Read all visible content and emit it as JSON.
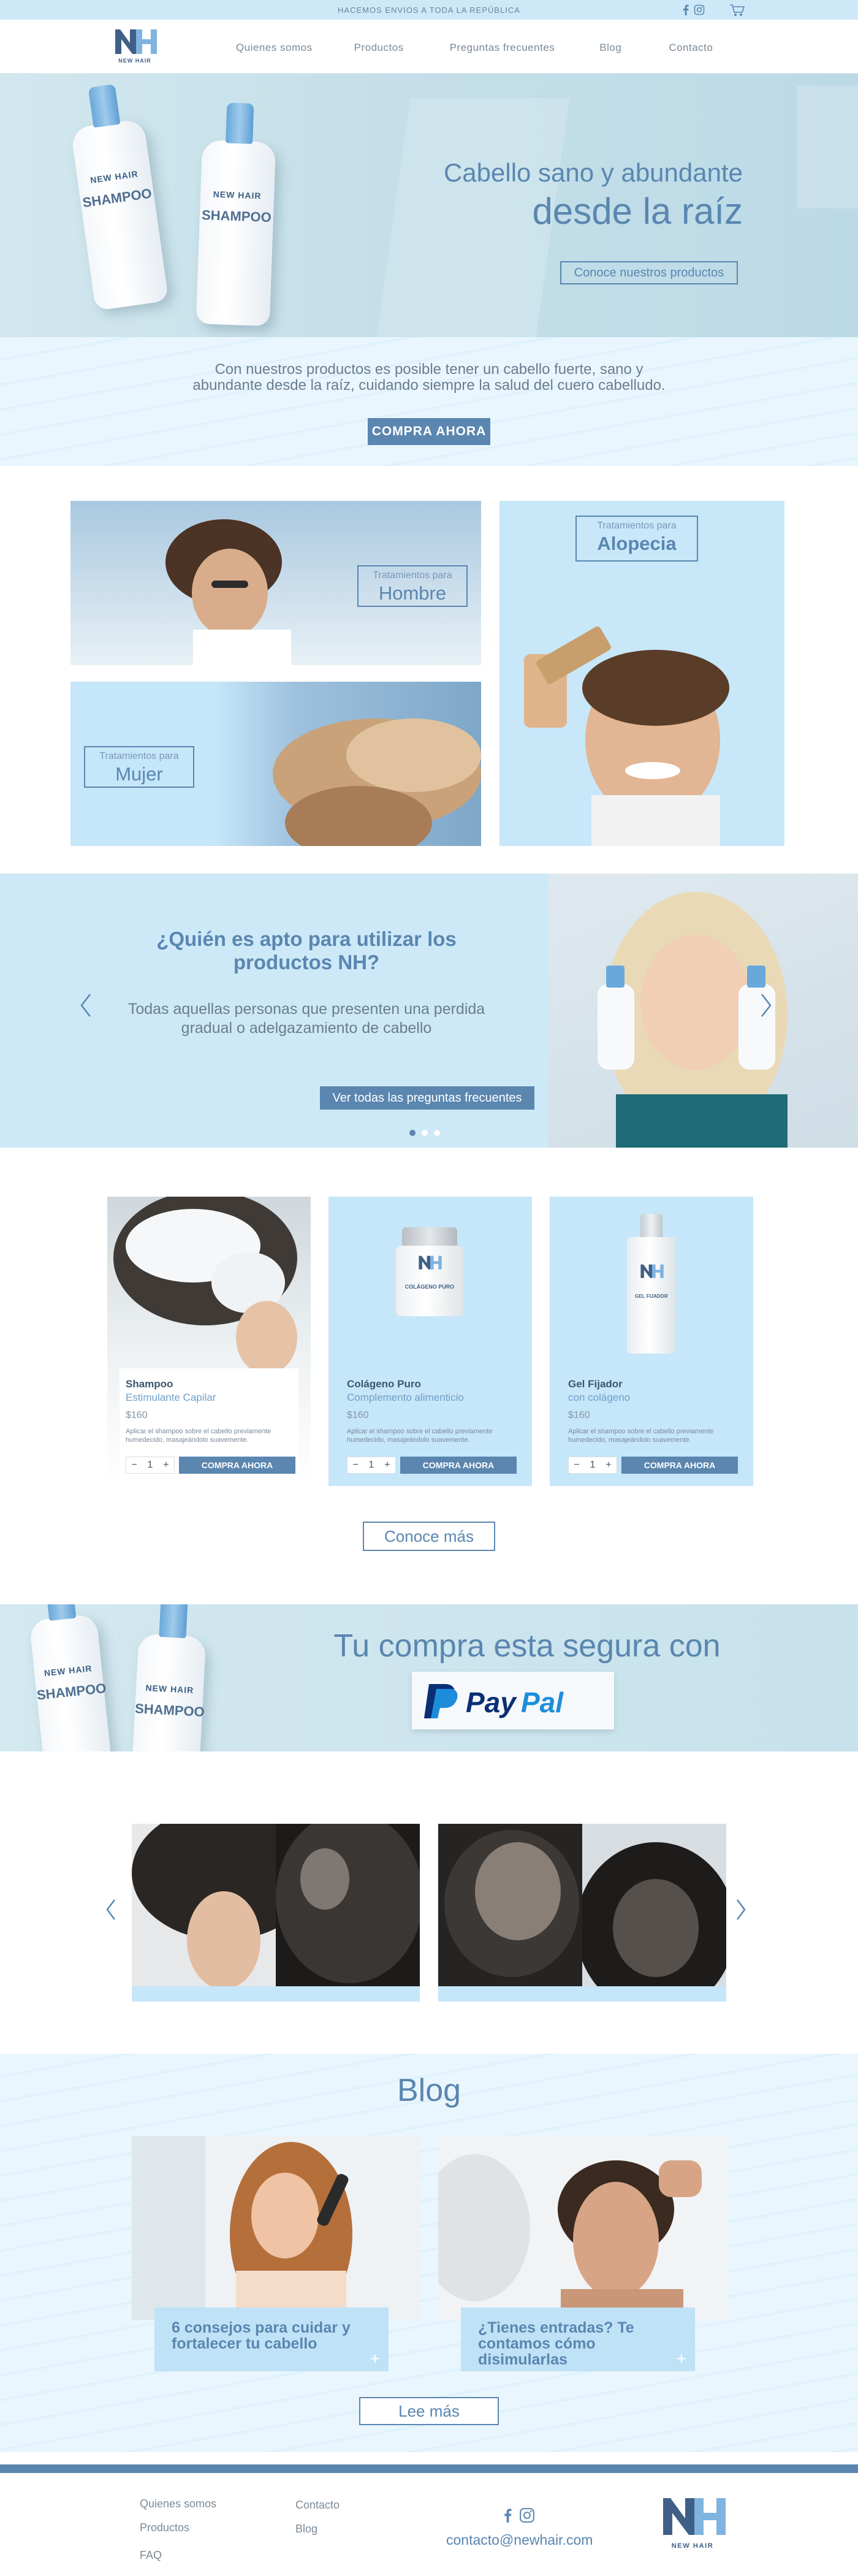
{
  "topbar": {
    "shipping": "HACEMOS ENVIOS A TODA LA REPÚBLICA",
    "social_icons": [
      "facebook-icon",
      "instagram-icon"
    ],
    "cart_icon": "cart-icon"
  },
  "brand": {
    "logo_text": "NEW HAIR",
    "logo_letters": "NH",
    "accent_color": "#5a86b0",
    "light_blue": "#cde9f8"
  },
  "nav": {
    "items": [
      {
        "label": "Quienes somos"
      },
      {
        "label": "Productos"
      },
      {
        "label": "Preguntas frecuentes"
      },
      {
        "label": "Blog"
      },
      {
        "label": "Contacto"
      }
    ]
  },
  "hero": {
    "title_line1": "Cabello sano y abundante",
    "title_line2": "desde la raíz",
    "cta": "Conoce nuestros productos",
    "bottle_brand": "NEW HAIR",
    "bottle_product": "SHAMPOO"
  },
  "intro": {
    "text": "Con nuestros productos es posible tener un cabello fuerte, sano y abundante desde la raíz, cuidando siempre la salud del cuero cabelludo.",
    "button": "COMPRA AHORA"
  },
  "treatments": [
    {
      "small": "Tratamientos para",
      "big": "Hombre"
    },
    {
      "small": "Tratamientos para",
      "big": "Mujer"
    },
    {
      "small": "Tratamientos para",
      "big": "Alopecia"
    }
  ],
  "faq": {
    "question": "¿Quién es apto para utilizar los productos NH?",
    "answer": "Todas aquellas personas que presenten una perdida gradual o adelgazamiento de cabello",
    "button": "Ver todas las preguntas frecuentes",
    "prev_icon": "chevron-left-icon",
    "next_icon": "chevron-right-icon",
    "slides_total": 3,
    "slide_active": 1
  },
  "products": [
    {
      "name": "Shampoo",
      "subtitle": "Estimulante Capilar",
      "price": "$160",
      "desc": "Aplicar el shampoo sobre el cabello previamente humedecido, masajeándolo suavemente.",
      "qty": "1",
      "minus": "−",
      "plus": "+",
      "button": "COMPRA AHORA"
    },
    {
      "name": "Colágeno Puro",
      "subtitle": "Complemento alimenticio",
      "price": "$160",
      "desc": "Aplicar el shampoo sobre el cabello previamente humedecido, masajeándolo suavemente.",
      "qty": "1",
      "minus": "−",
      "plus": "+",
      "button": "COMPRA AHORA",
      "label": "COLÁGENO PURO"
    },
    {
      "name": "Gel Fijador",
      "subtitle": "con colágeno",
      "price": "$160",
      "desc": "Aplicar el shampoo sobre el cabello previamente humedecido, masajeándolo suavemente.",
      "qty": "1",
      "minus": "−",
      "plus": "+",
      "button": "COMPRA AHORA",
      "label": "GEL FIJADOR"
    }
  ],
  "products_more": "Conoce más",
  "paypal": {
    "heading": "Tu compra esta segura con",
    "brand_pay": "Pay",
    "brand_pal": "Pal"
  },
  "before_after": {
    "prev_icon": "chevron-left-icon",
    "next_icon": "chevron-right-icon"
  },
  "blog": {
    "heading": "Blog",
    "posts": [
      {
        "title": "6 consejos para cuidar y fortalecer tu cabello",
        "plus": "+"
      },
      {
        "title": "¿Tienes entradas? Te contamos cómo disimularlas",
        "plus": "+"
      }
    ],
    "button": "Lee más"
  },
  "footer": {
    "col1": [
      "Quienes somos",
      "Productos",
      "FAQ"
    ],
    "col2": [
      "Contacto",
      "Blog"
    ],
    "email": "contacto@newhair.com",
    "logo_text": "NEW HAIR"
  }
}
